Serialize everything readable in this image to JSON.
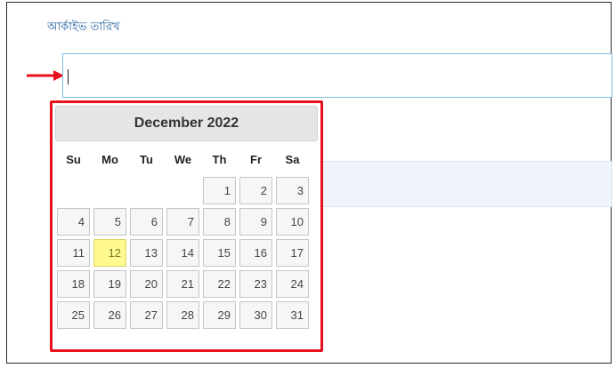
{
  "form": {
    "archive_date_label": "আর্কাইভ তারিখ",
    "archive_date_value": ""
  },
  "datepicker": {
    "month_year": "December 2022",
    "weekdays": [
      "Su",
      "Mo",
      "Tu",
      "We",
      "Th",
      "Fr",
      "Sa"
    ],
    "leading_blank_days": 4,
    "days": [
      1,
      2,
      3,
      4,
      5,
      6,
      7,
      8,
      9,
      10,
      11,
      12,
      13,
      14,
      15,
      16,
      17,
      18,
      19,
      20,
      21,
      22,
      23,
      24,
      25,
      26,
      27,
      28,
      29,
      30,
      31
    ],
    "highlighted_day": 12
  },
  "colors": {
    "annotation_red": "#e8101c",
    "input_border": "#7fbde6",
    "label_blue": "#1f5f9c",
    "highlight_yellow": "#fffa90"
  },
  "icons": {
    "pointer": "red-arrow-icon"
  }
}
